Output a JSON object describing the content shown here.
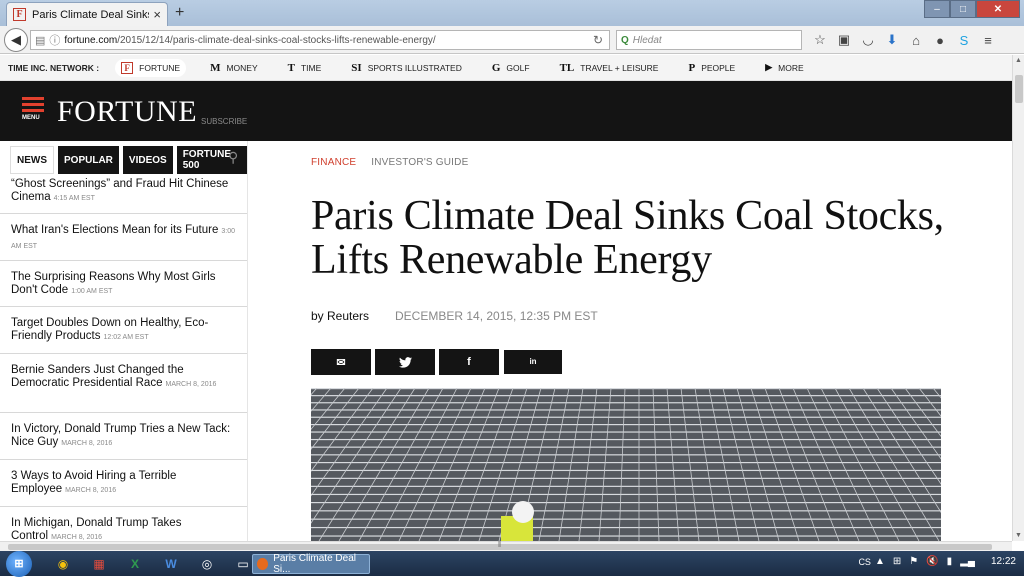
{
  "browser": {
    "tab_title": "Paris Climate Deal Sinks Co...",
    "tab_favicon": "F",
    "url_domain": "fortune.com",
    "url_path": "/2015/12/14/paris-climate-deal-sinks-coal-stocks-lifts-renewable-energy/",
    "search_placeholder": "Hledat",
    "window_controls": {
      "minimize": "–",
      "maximize": "□",
      "close": "✕"
    }
  },
  "network": {
    "label": "TIME INC. NETWORK :",
    "items": [
      {
        "icon": "F",
        "label": "FORTUNE"
      },
      {
        "icon": "M",
        "label": "MONEY"
      },
      {
        "icon": "T",
        "label": "TIME"
      },
      {
        "icon": "SI",
        "label": "SPORTS ILLUSTRATED"
      },
      {
        "icon": "G",
        "label": "GOLF"
      },
      {
        "icon": "TL",
        "label": "TRAVEL + LEISURE"
      },
      {
        "icon": "P",
        "label": "PEOPLE"
      },
      {
        "icon": "▶",
        "label": "MORE"
      }
    ]
  },
  "header": {
    "menu_label": "MENU",
    "logo": "FORTUNE",
    "subscribe": "SUBSCRIBE"
  },
  "sidebar": {
    "tabs": [
      "NEWS",
      "POPULAR",
      "VIDEOS",
      "FORTUNE 500"
    ],
    "items": [
      {
        "title": "“Ghost Screenings” and Fraud Hit Chinese Cinema",
        "time": "4:15 AM EST"
      },
      {
        "title": "What Iran's Elections Mean for its Future",
        "time": "3:00 AM EST"
      },
      {
        "title": "The Surprising Reasons Why Most Girls Don't Code",
        "time": "1:00 AM EST"
      },
      {
        "title": "Target Doubles Down on Healthy, Eco-Friendly Products",
        "time": "12:02 AM EST"
      },
      {
        "title": "Bernie Sanders Just Changed the Democratic Presidential Race",
        "time": "MARCH 8, 2016"
      },
      {
        "title": "In Victory, Donald Trump Tries a New Tack: Nice Guy",
        "time": "MARCH 8, 2016"
      },
      {
        "title": "3 Ways to Avoid Hiring a Terrible Employee",
        "time": "MARCH 8, 2016"
      },
      {
        "title": "In Michigan, Donald Trump Takes Control",
        "time": "MARCH 8, 2016"
      }
    ]
  },
  "article": {
    "category_primary": "FINANCE",
    "category_secondary": "INVESTOR'S GUIDE",
    "headline": "Paris Climate Deal Sinks Coal Stocks, Lifts Renewable Energy",
    "byline": "by Reuters",
    "date": "DECEMBER 14, 2015, 12:35 PM EST",
    "share": [
      {
        "name": "email",
        "glyph": "✉"
      },
      {
        "name": "twitter",
        "glyph": "🐦"
      },
      {
        "name": "facebook",
        "glyph": "f"
      },
      {
        "name": "linkedin",
        "glyph": "in"
      }
    ]
  },
  "taskbar": {
    "task_label": "Paris Climate Deal Si...",
    "language": "CS",
    "clock": "12:22"
  }
}
